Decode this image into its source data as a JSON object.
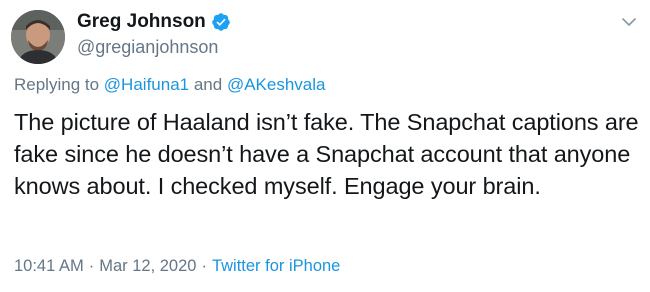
{
  "author": {
    "display_name": "Greg Johnson",
    "handle": "@gregianjohnson",
    "verified": true
  },
  "reply": {
    "prefix": "Replying to",
    "mention1": "@Haifuna1",
    "and": "and",
    "mention2": "@AKeshvala"
  },
  "tweet": {
    "text": "The picture of Haaland isn’t fake. The Snapchat captions are fake since he doesn’t have a Snapchat account that anyone knows about. I checked myself. Engage your brain."
  },
  "meta": {
    "time": "10:41 AM",
    "separator": "·",
    "date": "Mar 12, 2020",
    "source": "Twitter for iPhone"
  },
  "icons": {
    "verified": "verified-badge-icon",
    "menu": "chevron-down-icon"
  },
  "colors": {
    "link": "#1b95e0",
    "secondary_text": "#657786",
    "primary_text": "#14171a",
    "verified": "#1da1f2"
  }
}
